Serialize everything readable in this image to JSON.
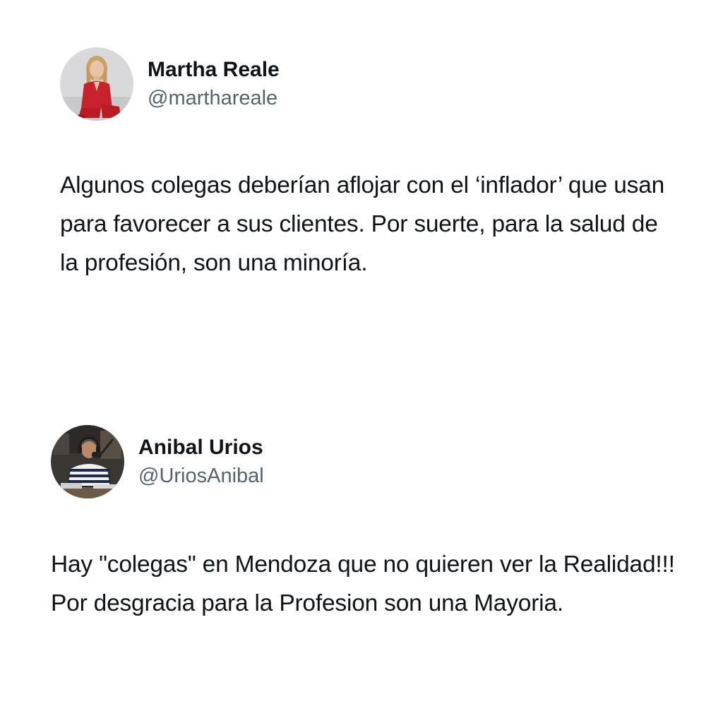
{
  "tweets": [
    {
      "author": {
        "display_name": "Martha Reale",
        "handle": "@marthareale",
        "avatar_icon": "avatar-photo-woman-red-suit"
      },
      "text": "Algunos colegas deberían aflojar con el ‘inflador’ que usan para favorecer a sus clientes. Por suerte, para la salud de la profesión, son una minoría."
    },
    {
      "author": {
        "display_name": "Anibal Urios",
        "handle": "@UriosAnibal",
        "avatar_icon": "avatar-photo-man-microphone"
      },
      "text": "Hay \"colegas\" en Mendoza que no quieren ver la Realidad!!! Por desgracia para la Profesion son una Mayoria."
    }
  ],
  "colors": {
    "text_primary": "#0f1419",
    "text_secondary": "#536471",
    "background": "#ffffff"
  }
}
